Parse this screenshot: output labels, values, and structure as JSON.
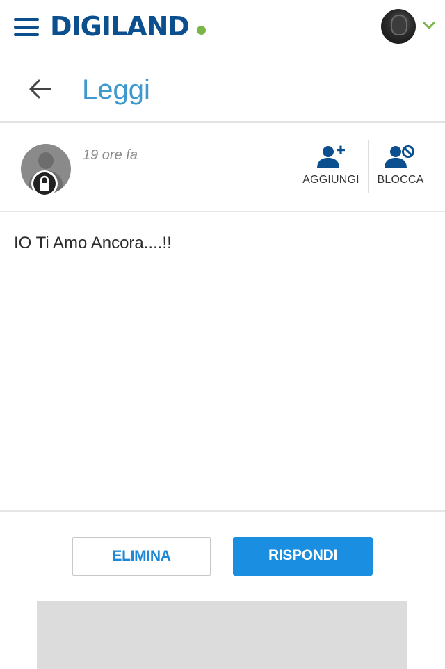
{
  "header": {
    "brand": "DIGILAND",
    "brand_dot_color": "#7ab648",
    "menu_icon": "hamburger-icon",
    "user_avatar": "user-avatar",
    "dropdown_icon": "chevron-down-icon"
  },
  "page": {
    "title": "Leggi",
    "back_icon": "arrow-left-icon"
  },
  "message_meta": {
    "time": "19 ore fa",
    "sender_avatar": "locked-profile-avatar",
    "actions": [
      {
        "label": "AGGIUNGI",
        "icon": "add-user-icon"
      },
      {
        "label": "BLOCCA",
        "icon": "block-user-icon"
      }
    ]
  },
  "message": {
    "body": "IO Ti Amo Ancora....!!"
  },
  "buttons": {
    "delete": "ELIMINA",
    "reply": "RISPONDI"
  },
  "colors": {
    "brand": "#0b4f8e",
    "accent": "#1a8ee0",
    "title": "#3f99cf"
  }
}
